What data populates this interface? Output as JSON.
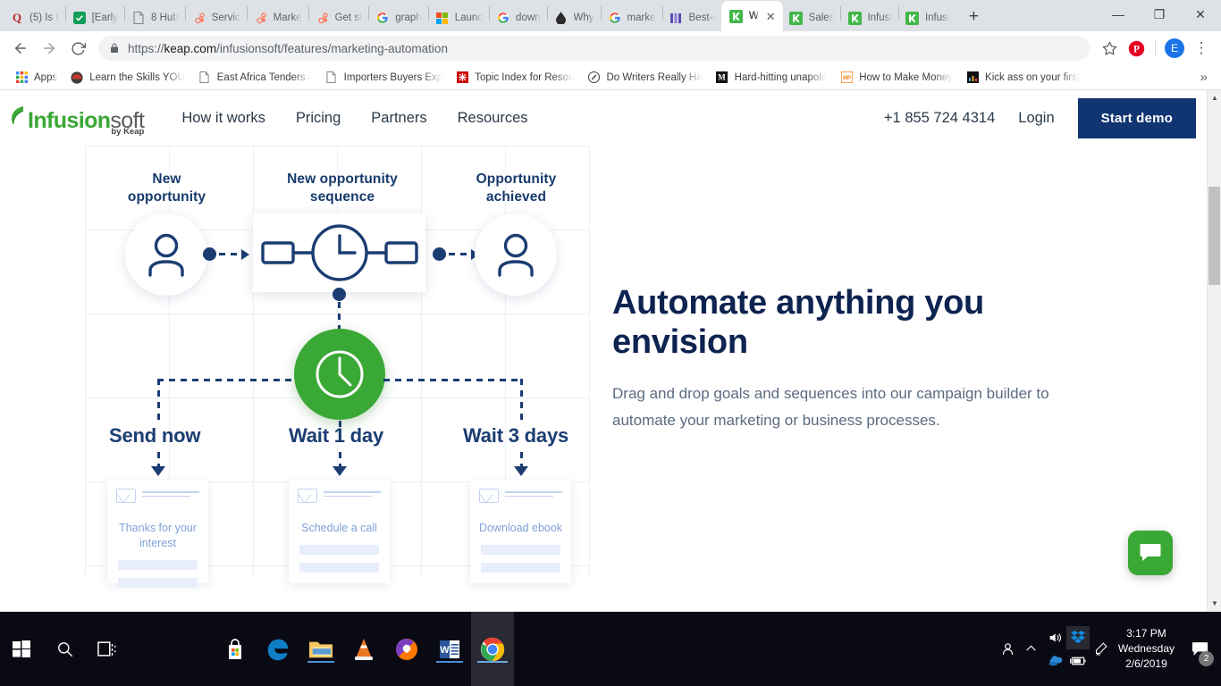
{
  "browser": {
    "tabs": [
      {
        "title": "(5) Is t",
        "icon": "quora-icon",
        "icon_text": "Q",
        "icon_color": "#b92b27",
        "active": false
      },
      {
        "title": "[Early",
        "icon": "sheets-icon",
        "icon_text": "",
        "icon_color": "#0f9d58",
        "active": false
      },
      {
        "title": "8 Hub",
        "icon": "document-icon",
        "icon_text": "",
        "icon_color": "#80868b",
        "active": false
      },
      {
        "title": "Servic",
        "icon": "hubspot-icon",
        "icon_text": "",
        "icon_color": "#ff7a59",
        "active": false
      },
      {
        "title": "Marke",
        "icon": "hubspot-icon",
        "icon_text": "",
        "icon_color": "#ff7a59",
        "active": false
      },
      {
        "title": "Get st",
        "icon": "hubspot-icon",
        "icon_text": "",
        "icon_color": "#ff7a59",
        "active": false
      },
      {
        "title": "graph",
        "icon": "google-icon",
        "icon_text": "G",
        "icon_color": "#4285f4",
        "active": false
      },
      {
        "title": "Launc",
        "icon": "microsoft-icon",
        "icon_text": "",
        "icon_color": "#00a4ef",
        "active": false
      },
      {
        "title": "down",
        "icon": "google-icon",
        "icon_text": "G",
        "icon_color": "#4285f4",
        "active": false
      },
      {
        "title": "Why",
        "icon": "ghost-icon",
        "icon_text": "",
        "icon_color": "#2b2b2b",
        "active": false
      },
      {
        "title": "marke",
        "icon": "google-icon",
        "icon_text": "G",
        "icon_color": "#4285f4",
        "active": false
      },
      {
        "title": "Best-i",
        "icon": "bars-icon",
        "icon_text": "",
        "icon_color": "#5b4bb5",
        "active": false
      },
      {
        "title": "W",
        "icon": "keap-icon",
        "icon_text": "k",
        "icon_color": "#41b649",
        "active": true
      },
      {
        "title": "Sales",
        "icon": "keap-icon",
        "icon_text": "k",
        "icon_color": "#41b649",
        "active": false
      },
      {
        "title": "Infusi",
        "icon": "keap-icon",
        "icon_text": "k",
        "icon_color": "#41b649",
        "active": false
      },
      {
        "title": "Infusi",
        "icon": "keap-icon",
        "icon_text": "k",
        "icon_color": "#41b649",
        "active": false
      }
    ],
    "new_tab_label": "+",
    "window_controls": {
      "minimize": "—",
      "maximize": "❐",
      "close": "✕"
    },
    "nav": {
      "back": "←",
      "forward": "→",
      "reload": "↻"
    },
    "omnibox": {
      "lock": "lock-icon",
      "scheme": "https://",
      "domain": "keap.com",
      "path": "/infusionsoft/features/marketing-automation",
      "full_url": "https://keap.com/infusionsoft/features/marketing-automation",
      "star": "☆"
    },
    "toolbar_icons": {
      "pinterest": "P",
      "profile_initial": "E",
      "menu": "⋮"
    },
    "bookmarks": [
      {
        "label": "Apps",
        "icon": "apps-grid-icon"
      },
      {
        "label": "Learn the Skills YOU",
        "icon": "page-icon-dark"
      },
      {
        "label": "East Africa Tenders -",
        "icon": "document-icon"
      },
      {
        "label": "Importers Buyers Exp",
        "icon": "document-icon"
      },
      {
        "label": "Topic Index for Resou",
        "icon": "red-square-icon"
      },
      {
        "label": "Do Writers Really Ha",
        "icon": "circle-icon"
      },
      {
        "label": "Hard-hitting unapolo",
        "icon": "medium-icon"
      },
      {
        "label": "How to Make Money",
        "icon": "orange-box-icon"
      },
      {
        "label": "Kick ass on your first",
        "icon": "dark-chart-icon"
      }
    ],
    "bookmarks_overflow": "»"
  },
  "site": {
    "logo": {
      "primary": "Infusion",
      "secondary": "soft",
      "tagline": "by Keap"
    },
    "nav_items": [
      "How it works",
      "Pricing",
      "Partners",
      "Resources"
    ],
    "phone": "+1 855 724 4314",
    "login_label": "Login",
    "demo_label": "Start demo"
  },
  "hero": {
    "heading": "Automate anything you envision",
    "body": "Drag and drop goals and sequences into our campaign builder to automate your marketing or business processes."
  },
  "illustration": {
    "goals": [
      {
        "label": "New opportunity",
        "type": "person"
      },
      {
        "label": "New opportunity sequence",
        "type": "sequence"
      },
      {
        "label": "Opportunity achieved",
        "type": "person"
      }
    ],
    "timer_icon": "clock-icon",
    "branches": [
      {
        "wait_label": "Send now",
        "email_title": "Thanks for your interest"
      },
      {
        "wait_label": "Wait 1 day",
        "email_title": "Schedule a call"
      },
      {
        "wait_label": "Wait 3 days",
        "email_title": "Download ebook"
      }
    ],
    "colors": {
      "navy": "#1b3d72",
      "green": "#3aa835",
      "grid": "#eceff6"
    }
  },
  "chat": {
    "icon": "chat-bubble-icon",
    "color": "#3aa835"
  },
  "taskbar": {
    "start": "windows-logo-icon",
    "search": "search-icon",
    "task_view": "task-view-icon",
    "apps": [
      {
        "name": "microsoft-store-icon",
        "state": "idle"
      },
      {
        "name": "edge-icon",
        "state": "idle"
      },
      {
        "name": "file-explorer-icon",
        "state": "running"
      },
      {
        "name": "vlc-icon",
        "state": "idle"
      },
      {
        "name": "avast-icon",
        "state": "idle"
      },
      {
        "name": "word-icon",
        "state": "running"
      },
      {
        "name": "chrome-icon",
        "state": "active"
      }
    ],
    "tray": {
      "people": "people-icon",
      "chevron": "show-hidden-icon",
      "volume": "volume-icon",
      "dropbox": "dropbox-icon",
      "onedrive": "onedrive-icon",
      "battery": "battery-icon",
      "pen": "pen-icon"
    },
    "clock": {
      "time": "3:17 PM",
      "day": "Wednesday",
      "date": "2/6/2019"
    },
    "notifications": {
      "icon": "notification-icon",
      "count": "2"
    }
  }
}
